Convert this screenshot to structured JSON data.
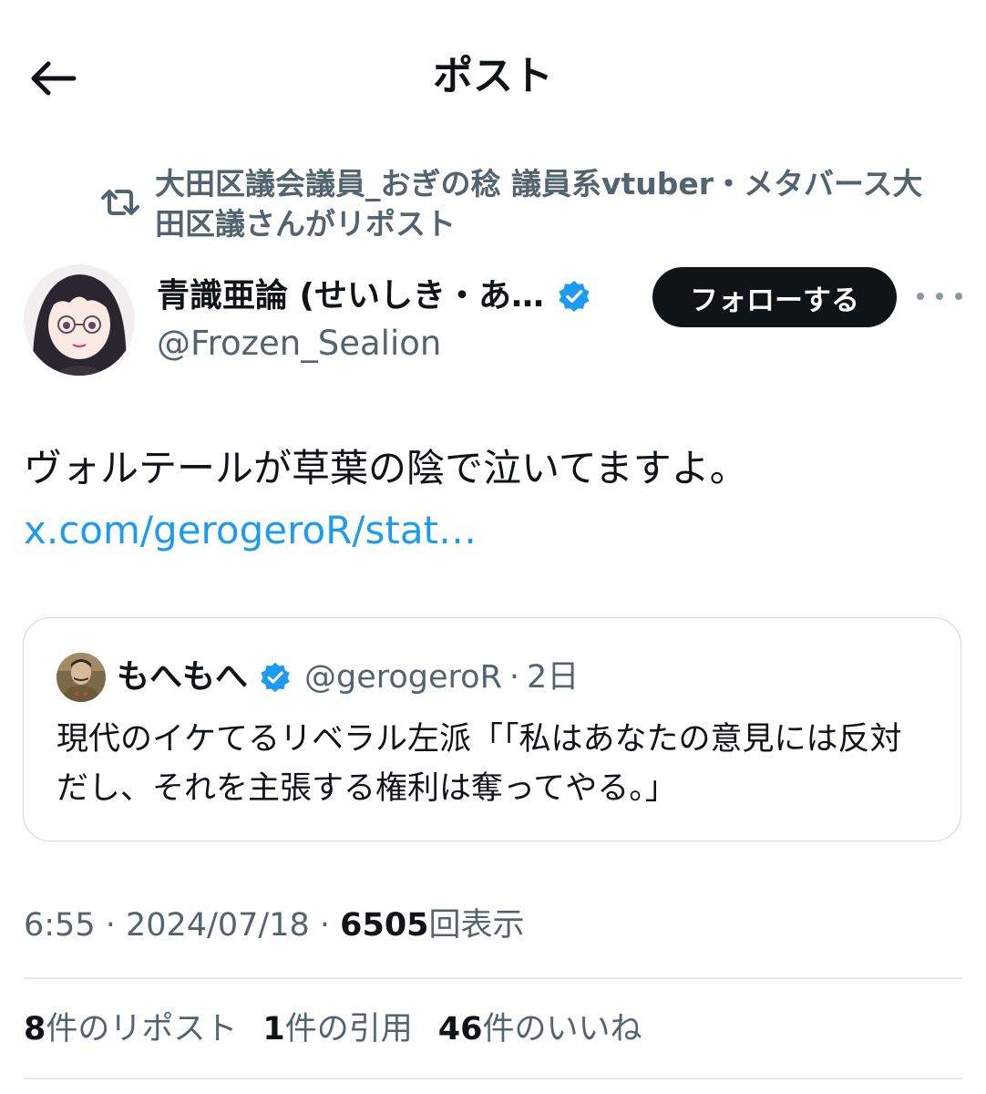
{
  "header": {
    "title": "ポスト",
    "back_icon": "arrow-left-icon"
  },
  "repost_banner": {
    "icon": "repost-icon",
    "text": "大田区議会議員_おぎの稔 議員系vtuber・メタバース大田区議さんがリポスト"
  },
  "author": {
    "display_name": "青識亜論 (せいしき・あ…",
    "verified_icon": "verified-badge-icon",
    "handle": "@Frozen_Sealion",
    "follow_label": "フォローする",
    "more_icon": "more-options-icon"
  },
  "post": {
    "text": "ヴォルテールが草葉の陰で泣いてますよ。",
    "link": "x.com/gerogeroR/stat…"
  },
  "quote": {
    "display_name": "もへもへ",
    "handle": "@gerogeroR",
    "separator": "·",
    "time": "2日",
    "text": "現代のイケてるリベラル左派「「私はあなたの意見には反対だし、それを主張する権利は奪ってやる。」"
  },
  "meta": {
    "time": "6:55",
    "sep1": " · ",
    "date": "2024/07/18",
    "sep2": " · ",
    "views_count": "6505",
    "views_label": "回表示"
  },
  "stats": {
    "reposts_count": "8",
    "reposts_label": "件のリポスト",
    "quotes_count": "1",
    "quotes_label": "件の引用",
    "likes_count": "46",
    "likes_label": "件のいいね"
  },
  "colors": {
    "primary_text": "#0f1419",
    "secondary_text": "#536471",
    "link": "#1d9bf0",
    "verified": "#1d9bf0",
    "follow_bg": "#0f1419",
    "border": "#cfd9de"
  }
}
